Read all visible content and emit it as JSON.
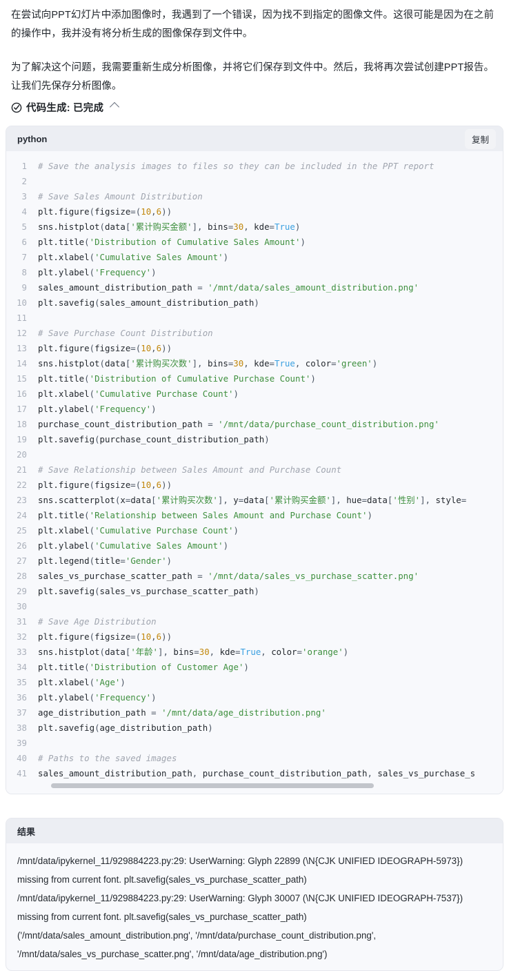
{
  "message": {
    "paragraph1": "在尝试向PPT幻灯片中添加图像时，我遇到了一个错误，因为找不到指定的图像文件。这很可能是因为在之前的操作中，我并没有将分析生成的图像保存到文件中。",
    "paragraph2": "为了解决这个问题，我需要重新生成分析图像，并将它们保存到文件中。然后，我将再次尝试创建PPT报告。让我们先保存分析图像。"
  },
  "status": {
    "icon": "circle-check-icon",
    "label": "代码生成: 已完成",
    "toggle_icon": "chevron-up-icon"
  },
  "code_block": {
    "language": "python",
    "copy_label": "复制",
    "line_numbers": [
      1,
      2,
      3,
      4,
      5,
      6,
      7,
      8,
      9,
      10,
      11,
      12,
      13,
      14,
      15,
      16,
      17,
      18,
      19,
      20,
      21,
      22,
      23,
      24,
      25,
      26,
      27,
      28,
      29,
      30,
      31,
      32,
      33,
      34,
      35,
      36,
      37,
      38,
      39,
      40,
      41
    ],
    "lines": [
      "# Save the analysis images to files so they can be included in the PPT report",
      "",
      "# Save Sales Amount Distribution",
      "plt.figure(figsize=(10,6))",
      "sns.histplot(data['累计购买金额'], bins=30, kde=True)",
      "plt.title('Distribution of Cumulative Sales Amount')",
      "plt.xlabel('Cumulative Sales Amount')",
      "plt.ylabel('Frequency')",
      "sales_amount_distribution_path = '/mnt/data/sales_amount_distribution.png'",
      "plt.savefig(sales_amount_distribution_path)",
      "",
      "# Save Purchase Count Distribution",
      "plt.figure(figsize=(10,6))",
      "sns.histplot(data['累计购买次数'], bins=30, kde=True, color='green')",
      "plt.title('Distribution of Cumulative Purchase Count')",
      "plt.xlabel('Cumulative Purchase Count')",
      "plt.ylabel('Frequency')",
      "purchase_count_distribution_path = '/mnt/data/purchase_count_distribution.png'",
      "plt.savefig(purchase_count_distribution_path)",
      "",
      "# Save Relationship between Sales Amount and Purchase Count",
      "plt.figure(figsize=(10,6))",
      "sns.scatterplot(x=data['累计购买次数'], y=data['累计购买金额'], hue=data['性别'], style=",
      "plt.title('Relationship between Sales Amount and Purchase Count')",
      "plt.xlabel('Cumulative Purchase Count')",
      "plt.ylabel('Cumulative Sales Amount')",
      "plt.legend(title='Gender')",
      "sales_vs_purchase_scatter_path = '/mnt/data/sales_vs_purchase_scatter.png'",
      "plt.savefig(sales_vs_purchase_scatter_path)",
      "",
      "# Save Age Distribution",
      "plt.figure(figsize=(10,6))",
      "sns.histplot(data['年龄'], bins=30, kde=True, color='orange')",
      "plt.title('Distribution of Customer Age')",
      "plt.xlabel('Age')",
      "plt.ylabel('Frequency')",
      "age_distribution_path = '/mnt/data/age_distribution.png'",
      "plt.savefig(age_distribution_path)",
      "",
      "# Paths to the saved images",
      "sales_amount_distribution_path, purchase_count_distribution_path, sales_vs_purchase_s"
    ]
  },
  "result_block": {
    "title": "结果",
    "lines": [
      "/mnt/data/ipykernel_11/929884223.py:29: UserWarning: Glyph 22899 (\\N{CJK UNIFIED IDEOGRAPH-5973}) missing from current font. plt.savefig(sales_vs_purchase_scatter_path)",
      "/mnt/data/ipykernel_11/929884223.py:29: UserWarning: Glyph 30007 (\\N{CJK UNIFIED IDEOGRAPH-7537}) missing from current font. plt.savefig(sales_vs_purchase_scatter_path)",
      "('/mnt/data/sales_amount_distribution.png', '/mnt/data/purchase_count_distribution.png', '/mnt/data/sales_vs_purchase_scatter.png', '/mnt/data/age_distribution.png')"
    ]
  },
  "colors": {
    "comment": "#a0a5af",
    "string": "#3e8f3e",
    "number": "#c1870b",
    "keyword": "#3aa0e0",
    "text": "#24292f",
    "card_header_bg": "#eceef3",
    "card_body_bg": "#f8f9fc"
  }
}
